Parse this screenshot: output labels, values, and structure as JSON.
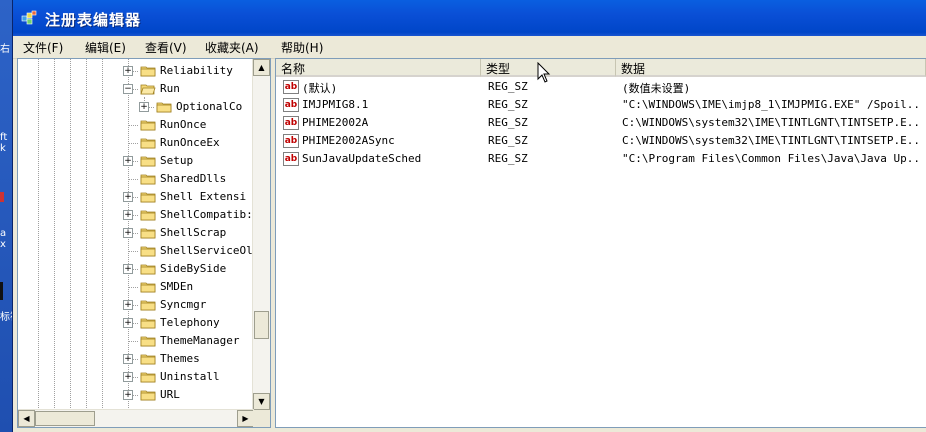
{
  "window": {
    "title": "注册表编辑器"
  },
  "menu": [
    "文件(F)",
    "编辑(E)",
    "查看(V)",
    "收藏夹(A)",
    "帮助(H)"
  ],
  "desktop_fragments": [
    "右",
    "ft\nk",
    "a\nx",
    "标符"
  ],
  "tree": {
    "items": [
      {
        "label": "Reliability",
        "expander": "+"
      },
      {
        "label": "Run",
        "expander": "−",
        "open": true
      },
      {
        "label": "OptionalCo",
        "expander": "+",
        "child": true
      },
      {
        "label": "RunOnce",
        "expander": ""
      },
      {
        "label": "RunOnceEx",
        "expander": ""
      },
      {
        "label": "Setup",
        "expander": "+"
      },
      {
        "label": "SharedDlls",
        "expander": ""
      },
      {
        "label": "Shell Extensi",
        "expander": "+"
      },
      {
        "label": "ShellCompatib:",
        "expander": "+"
      },
      {
        "label": "ShellScrap",
        "expander": "+"
      },
      {
        "label": "ShellServiceOl",
        "expander": ""
      },
      {
        "label": "SideBySide",
        "expander": "+"
      },
      {
        "label": "SMDEn",
        "expander": ""
      },
      {
        "label": "Syncmgr",
        "expander": "+"
      },
      {
        "label": "Telephony",
        "expander": "+"
      },
      {
        "label": "ThemeManager",
        "expander": ""
      },
      {
        "label": "Themes",
        "expander": "+"
      },
      {
        "label": "Uninstall",
        "expander": "+"
      },
      {
        "label": "URL",
        "expander": "+"
      }
    ]
  },
  "list": {
    "columns": [
      "名称",
      "类型",
      "数据"
    ],
    "rows": [
      {
        "name": "(默认)",
        "type": "REG_SZ",
        "data": "(数值未设置)"
      },
      {
        "name": "IMJPMIG8.1",
        "type": "REG_SZ",
        "data": "\"C:\\WINDOWS\\IME\\imjp8_1\\IMJPMIG.EXE\" /Spoil..."
      },
      {
        "name": "PHIME2002A",
        "type": "REG_SZ",
        "data": "C:\\WINDOWS\\system32\\IME\\TINTLGNT\\TINTSETP.E..."
      },
      {
        "name": "PHIME2002ASync",
        "type": "REG_SZ",
        "data": "C:\\WINDOWS\\system32\\IME\\TINTLGNT\\TINTSETP.E..."
      },
      {
        "name": "SunJavaUpdateSched",
        "type": "REG_SZ",
        "data": "\"C:\\Program Files\\Common Files\\Java\\Java Up..."
      }
    ],
    "value_icon": "ab-string-icon"
  },
  "colors": {
    "titlebar": "#0a4fd6",
    "selection": "#316ac5",
    "window_bg": "#ece9d8"
  }
}
